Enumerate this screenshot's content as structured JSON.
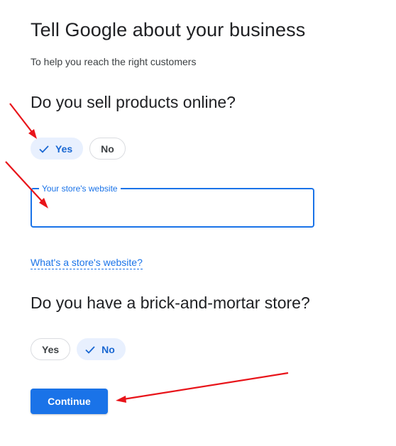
{
  "header": {
    "title": "Tell Google about your business",
    "subtitle": "To help you reach the right customers"
  },
  "online_sales": {
    "question": "Do you sell products online?",
    "options": [
      {
        "label": "Yes",
        "selected": true
      },
      {
        "label": "No",
        "selected": false
      }
    ]
  },
  "website_field": {
    "label": "Your store's website",
    "value": ""
  },
  "help_link": {
    "label": "What's a store's website?"
  },
  "physical_store": {
    "question": "Do you have a brick-and-mortar store?",
    "options": [
      {
        "label": "Yes",
        "selected": false
      },
      {
        "label": "No",
        "selected": true
      }
    ]
  },
  "actions": {
    "continue_label": "Continue"
  },
  "colors": {
    "accent": "#1a73e8",
    "chip_selected_bg": "#e8f0fe",
    "annotation_arrow": "#e8141a"
  },
  "icons": [
    "check-icon",
    "annotation-arrow"
  ]
}
